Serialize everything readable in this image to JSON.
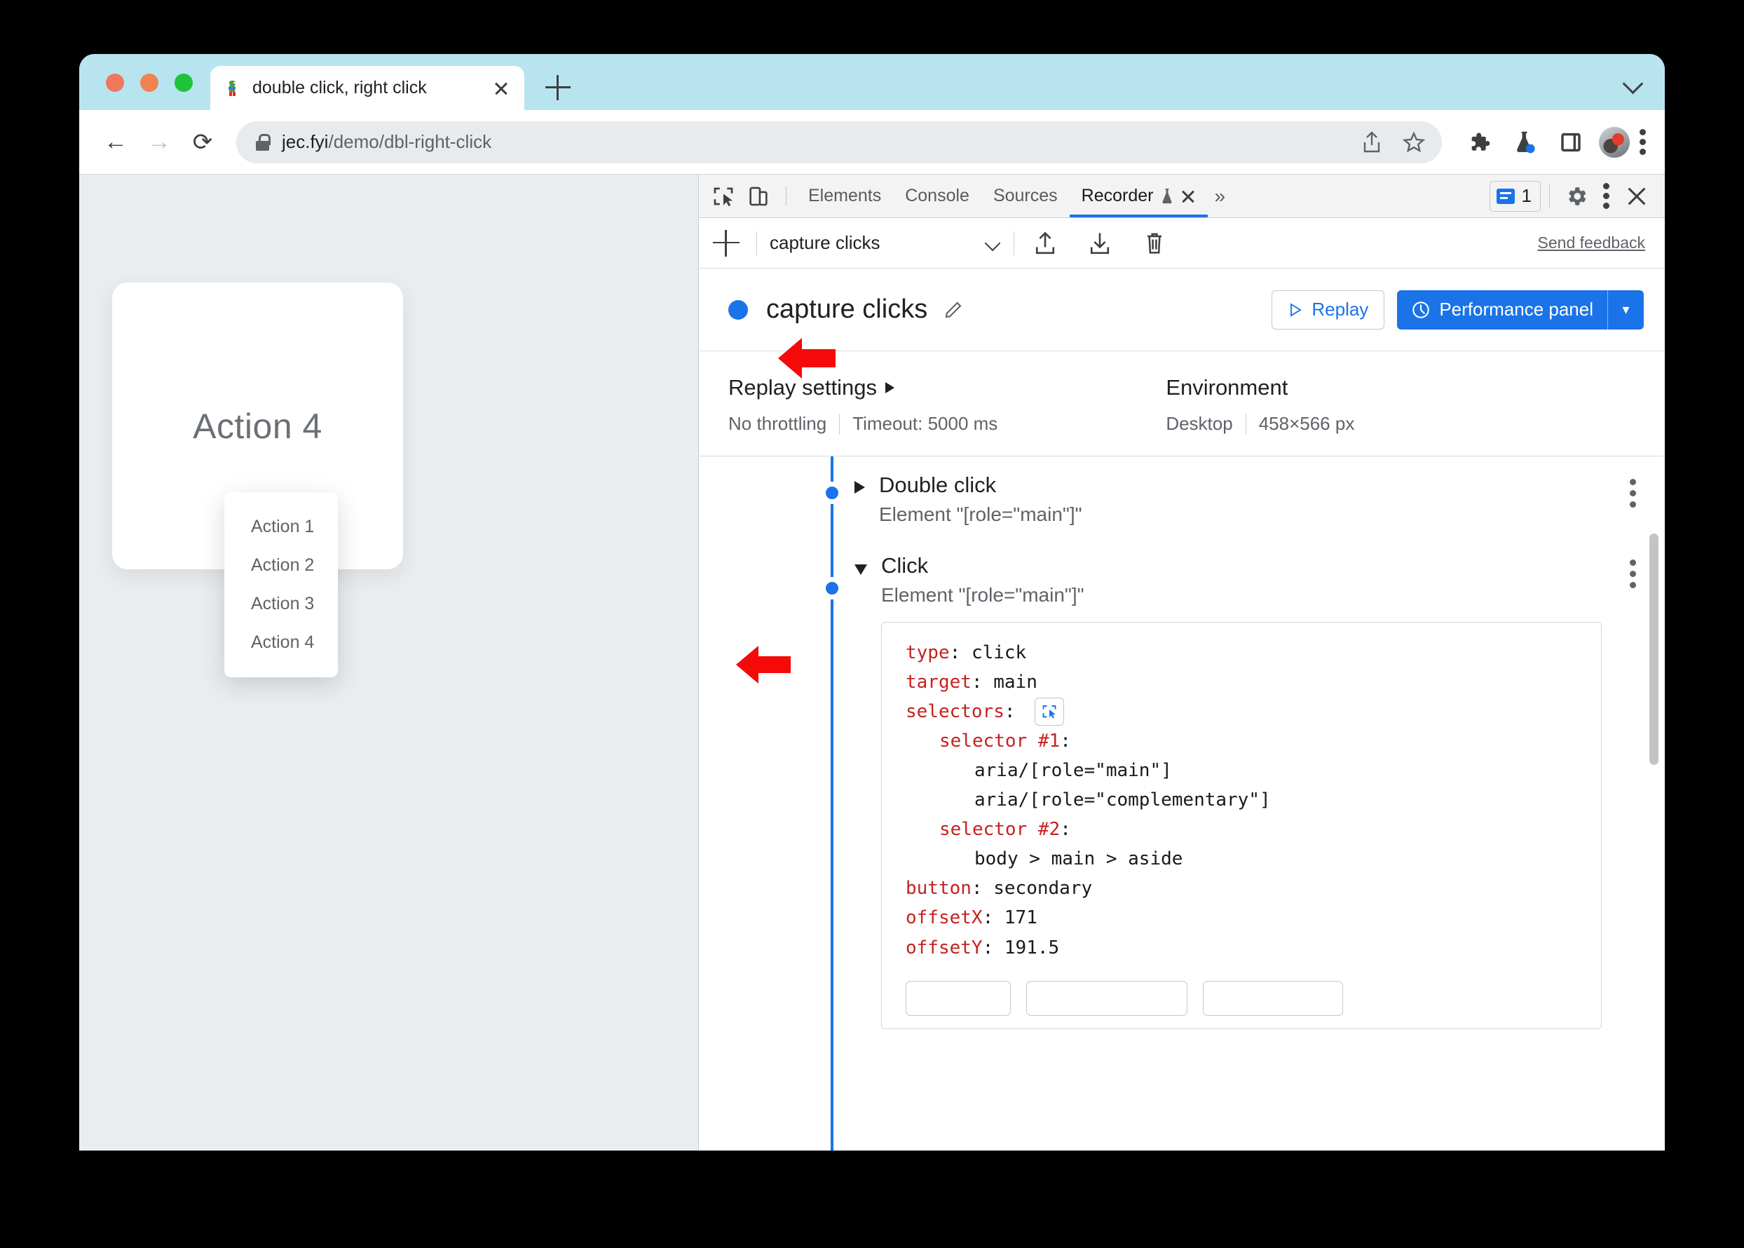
{
  "browser": {
    "tab": {
      "title": "double click, right click",
      "favicon": "dino-favicon",
      "close": "×"
    },
    "new_tab": "+",
    "nav": {
      "back": "←",
      "forward": "→",
      "reload": "⟳"
    },
    "omnibox": {
      "lock": "lock-icon",
      "url_host": "jec.fyi",
      "url_path": "/demo/dbl-right-click",
      "share": "share-icon",
      "bookmark": "star-icon"
    },
    "toolbar_icons": [
      "extensions-puzzle-icon",
      "experiments-flask-icon",
      "side-panel-icon",
      "profile-avatar",
      "chrome-menu-icon"
    ]
  },
  "page": {
    "card_label": "Action 4",
    "context_menu": [
      "Action 1",
      "Action 2",
      "Action 3",
      "Action 4"
    ]
  },
  "devtools": {
    "inspect_icon": "inspect-element-icon",
    "device_icon": "device-toolbar-icon",
    "tabs": [
      {
        "label": "Elements",
        "active": false
      },
      {
        "label": "Console",
        "active": false
      },
      {
        "label": "Sources",
        "active": false
      },
      {
        "label": "Recorder",
        "active": true,
        "experimental": true,
        "closeable": true
      }
    ],
    "more_tabs": "»",
    "issues_count": "1",
    "settings_icon": "gear-icon",
    "more_icon": "more-options-icon",
    "close_icon": "close-devtools-icon"
  },
  "recorder": {
    "add_recording": "+",
    "selected_recording": "capture clicks",
    "import_icon": "import-icon",
    "export_icon": "export-icon",
    "delete_icon": "delete-icon",
    "send_feedback": "Send feedback",
    "header": {
      "title": "capture clicks",
      "edit_icon": "pencil-edit-icon",
      "replay_label": "Replay",
      "performance_label": "Performance panel",
      "performance_caret": "▾"
    },
    "replay_settings": {
      "heading": "Replay settings",
      "throttling": "No throttling",
      "timeout": "Timeout: 5000 ms"
    },
    "environment": {
      "heading": "Environment",
      "device": "Desktop",
      "viewport": "458×566 px"
    },
    "steps": [
      {
        "title": "Double click",
        "subtitle": "Element \"[role=\"main\"]\"",
        "expanded": false
      },
      {
        "title": "Click",
        "subtitle": "Element \"[role=\"main\"]\"",
        "expanded": true,
        "details": {
          "type_key": "type",
          "type_value": "click",
          "target_key": "target",
          "target_value": "main",
          "selectors_key": "selectors",
          "selector1_key": "selector #1",
          "selector1_values": [
            "aria/[role=\"main\"]",
            "aria/[role=\"complementary\"]"
          ],
          "selector2_key": "selector #2",
          "selector2_values": [
            "body > main > aside"
          ],
          "button_key": "button",
          "button_value": "secondary",
          "offsetx_key": "offsetX",
          "offsetx_value": "171",
          "offsety_key": "offsetY",
          "offsety_value": "191.5"
        }
      }
    ]
  },
  "annotations": {
    "arrow_color": "#f60909",
    "arrow_1_target": "Double click step",
    "arrow_2_target": "button: secondary line"
  }
}
